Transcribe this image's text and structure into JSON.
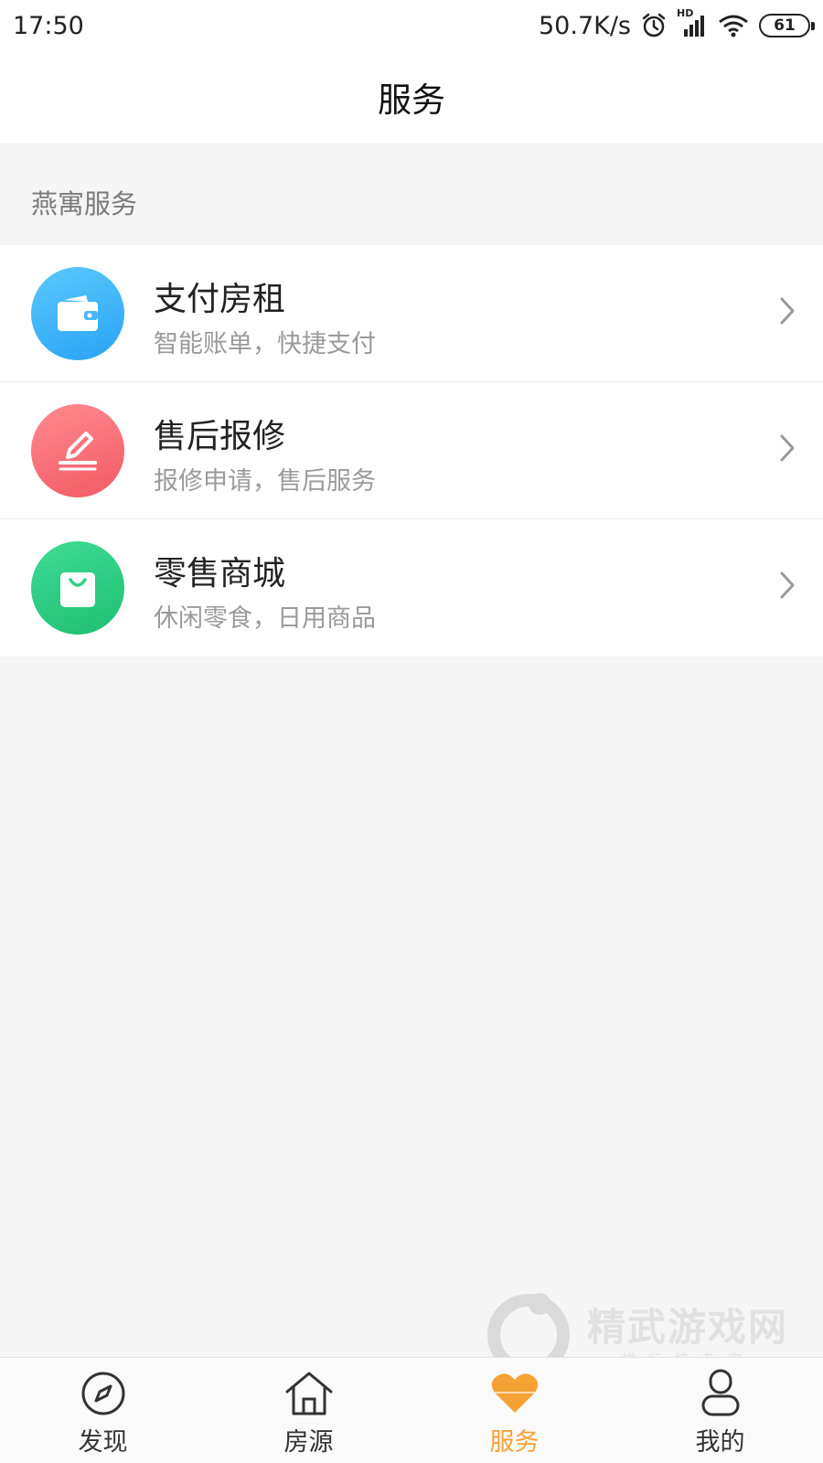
{
  "status_bar": {
    "time": "17:50",
    "net_speed": "50.7K/s",
    "signal_label": "HD",
    "battery": "61"
  },
  "header": {
    "title": "服务"
  },
  "section": {
    "title": "燕寓服务"
  },
  "services": [
    {
      "title": "支付房租",
      "subtitle": "智能账单，快捷支付",
      "icon": "wallet-icon",
      "color": "#2aa3f6"
    },
    {
      "title": "售后报修",
      "subtitle": "报修申请，售后服务",
      "icon": "pencil-icon",
      "color": "#f25a64"
    },
    {
      "title": "零售商城",
      "subtitle": "休闲零食，日用商品",
      "icon": "shopping-bag-icon",
      "color": "#1fbf73"
    }
  ],
  "watermark": {
    "text": "精武游戏网",
    "subtext": "排行榜专家"
  },
  "tabs": [
    {
      "label": "发现",
      "icon": "compass-icon",
      "active": false
    },
    {
      "label": "房源",
      "icon": "house-icon",
      "active": false
    },
    {
      "label": "服务",
      "icon": "heart-icon",
      "active": true
    },
    {
      "label": "我的",
      "icon": "person-icon",
      "active": false
    }
  ],
  "colors": {
    "accent": "#f5a234",
    "background": "#f5f5f5"
  }
}
